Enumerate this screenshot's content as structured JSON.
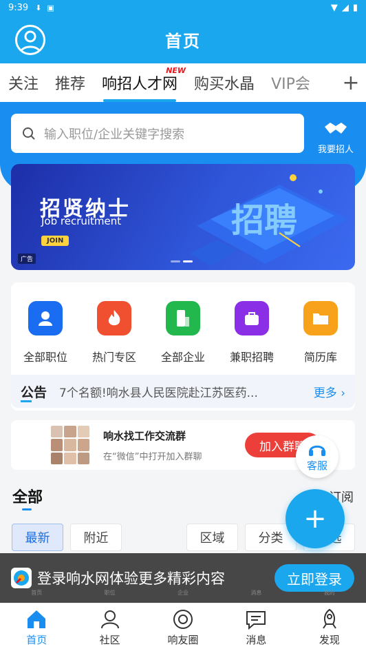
{
  "status_bar": {
    "time": "9:39"
  },
  "header": {
    "title": "首页"
  },
  "tabs": [
    {
      "label": "关注"
    },
    {
      "label": "推荐"
    },
    {
      "label": "响招人才网",
      "badge": "NEW",
      "active": true
    },
    {
      "label": "购买水晶"
    },
    {
      "label": "VIP会"
    }
  ],
  "search": {
    "placeholder": "输入职位/企业关键字搜索"
  },
  "recruit_button": {
    "label": "我要招人"
  },
  "banner": {
    "title": "招贤纳士",
    "subtitle": "Job recruitment",
    "join": "JOIN",
    "ad_tag": "广告",
    "art_text": "招聘"
  },
  "quick_links": [
    {
      "label": "全部职位",
      "color": "#1a6cf0",
      "icon": "user-icon"
    },
    {
      "label": "热门专区",
      "color": "#f0502f",
      "icon": "fire-icon"
    },
    {
      "label": "全部企业",
      "color": "#22b84d",
      "icon": "building-icon"
    },
    {
      "label": "兼职招聘",
      "color": "#8b2fe6",
      "icon": "bag-icon"
    },
    {
      "label": "简历库",
      "color": "#f7a21a",
      "icon": "folder-icon"
    }
  ],
  "notice": {
    "title": "公告",
    "text": "7个名额!响水县人民医院赴江苏医药...",
    "more": "更多"
  },
  "group_card": {
    "title": "响水找工作交流群",
    "subtitle": "在“微信”中打开加入群聊",
    "button": "加入群聊"
  },
  "service": {
    "label": "客服"
  },
  "section": {
    "title": "全部",
    "subscribe": "订阅"
  },
  "filters": [
    {
      "label": "最新",
      "active": true
    },
    {
      "label": "附近"
    },
    {
      "label": "区域"
    },
    {
      "label": "分类"
    },
    {
      "label": "筛选"
    }
  ],
  "login_bar": {
    "message": "登录响水网体验更多精彩内容",
    "button": "立即登录"
  },
  "ghost_nav": [
    "首页",
    "职位",
    "企业",
    "消息",
    "我的"
  ],
  "bottom_nav": [
    {
      "label": "首页",
      "active": true
    },
    {
      "label": "社区"
    },
    {
      "label": "响友圈"
    },
    {
      "label": "消息"
    },
    {
      "label": "发现"
    }
  ]
}
